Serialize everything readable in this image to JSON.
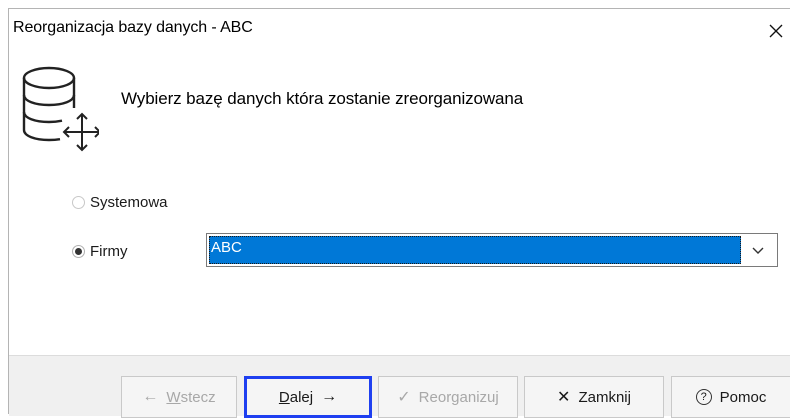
{
  "window": {
    "title": "Reorganizacja bazy danych - ABC",
    "close_glyph": "✕"
  },
  "header": {
    "text": "Wybierz bazę danych która zostanie zreorganizowana",
    "icon": "database-move-icon"
  },
  "options": {
    "systemowa": {
      "label": "Systemowa",
      "checked": false
    },
    "firmy": {
      "label": "Firmy",
      "checked": true
    }
  },
  "database_select": {
    "selected": "ABC",
    "arrow_glyph": "⌵"
  },
  "buttons": {
    "back": {
      "label_u": "W",
      "label_rest": "stecz",
      "glyph": "←",
      "enabled": false
    },
    "next": {
      "label_u": "D",
      "label_rest": "alej",
      "glyph": "→",
      "enabled": true,
      "focused": true
    },
    "reorganize": {
      "label": "Reorganizuj",
      "glyph": "✓",
      "enabled": false
    },
    "close": {
      "label": "Zamknij",
      "glyph": "✕",
      "enabled": true
    },
    "help": {
      "label": "Pomoc",
      "glyph": "?",
      "enabled": true
    }
  },
  "colors": {
    "selection": "#0078d7",
    "focus_border": "#1e3ff0",
    "button_bar": "#f0f0f0"
  }
}
